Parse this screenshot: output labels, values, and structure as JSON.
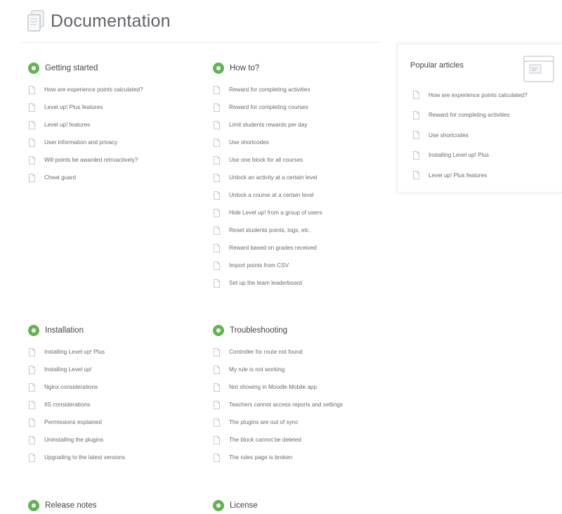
{
  "header": {
    "title": "Documentation"
  },
  "sections": {
    "getting_started": {
      "title": "Getting started",
      "items": [
        "How are experience points calculated?",
        "Level up! Plus features",
        "Level up! features",
        "User information and privacy",
        "Will points be awarded retroactively?",
        "Cheat guard"
      ]
    },
    "how_to": {
      "title": "How to?",
      "items": [
        "Reward for completing activities",
        "Reward for completing courses",
        "Limit students rewards per day",
        "Use shortcodes",
        "Use one block for all courses",
        "Unlock an activity at a certain level",
        "Unlock a course at a certain level",
        "Hide Level up! from a group of users",
        "Reset students points, logs, etc.",
        "Reward based on grades received",
        "Import points from CSV",
        "Set up the team leaderboard"
      ]
    },
    "installation": {
      "title": "Installation",
      "items": [
        "Installing Level up! Plus",
        "Installing Level up!",
        "Nginx considerations",
        "IIS considerations",
        "Permissions explained",
        "Uninstalling the plugins",
        "Upgrading to the latest versions"
      ]
    },
    "troubleshooting": {
      "title": "Troubleshooting",
      "items": [
        "Controller for route not found",
        "My rule is not working",
        "Not showing in Moodle Mobile app",
        "Teachers cannot access reports and settings",
        "The plugins are out of sync",
        "The block cannot be deleted",
        "The rules page is broken"
      ]
    },
    "release_notes": {
      "title": "Release notes"
    },
    "license": {
      "title": "License"
    }
  },
  "popular": {
    "title": "Popular articles",
    "items": [
      "How are experience points calculated?",
      "Reward for completing activities",
      "Use shortcodes",
      "Installing Level up! Plus",
      "Level up! Plus features"
    ]
  },
  "colors": {
    "accent": "#5fb54f",
    "text": "#6b6b6b",
    "heading": "#5f6368"
  },
  "icons": {
    "header": "documents-icon",
    "item": "document-icon",
    "badge": "section-badge-icon",
    "popular": "browser-window-icon"
  }
}
